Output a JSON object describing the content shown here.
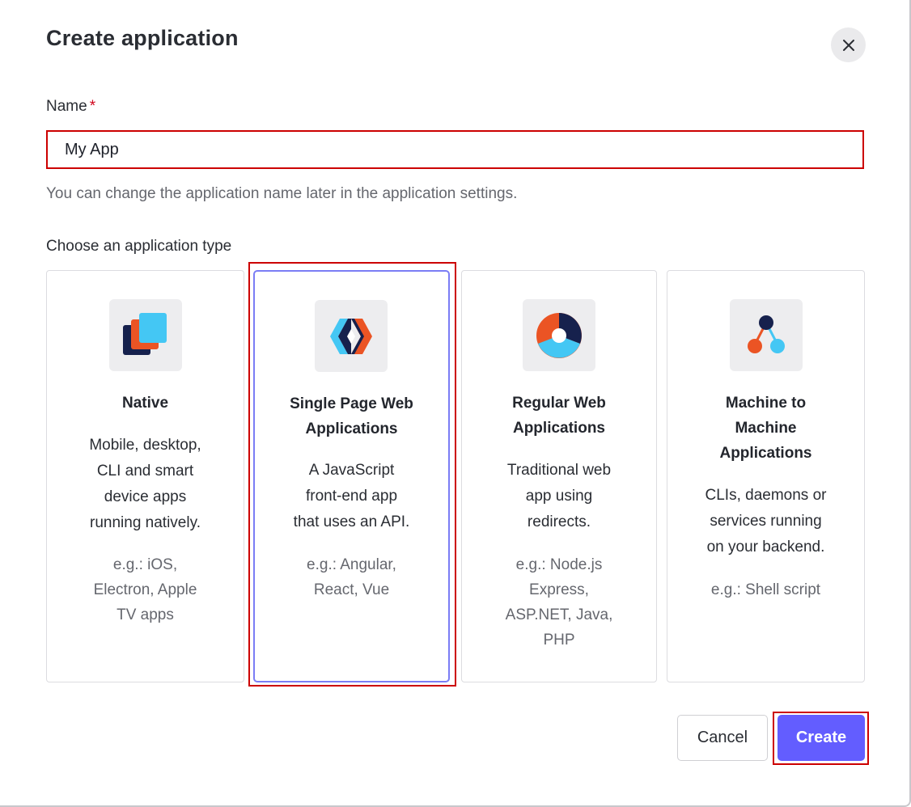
{
  "dialog": {
    "title": "Create application",
    "close_icon": "close-icon"
  },
  "name_field": {
    "label": "Name",
    "required_marker": "*",
    "value": "My App",
    "helper": "You can change the application name later in the application settings."
  },
  "app_type": {
    "label": "Choose an application type",
    "selected": "Single Page Web Applications",
    "cards": [
      {
        "icon": "native-stacked-squares-icon",
        "title_lines": [
          "Native"
        ],
        "desc_lines": [
          "Mobile, desktop,",
          "CLI and smart",
          "device apps",
          "running natively."
        ],
        "example_lines": [
          "e.g.: iOS,",
          "Electron, Apple",
          "TV apps"
        ]
      },
      {
        "icon": "spa-diamond-icon",
        "title_lines": [
          "Single Page Web",
          "Applications"
        ],
        "desc_lines": [
          "A JavaScript",
          "front-end app",
          "that uses an API."
        ],
        "example_lines": [
          "e.g.: Angular,",
          "React, Vue"
        ]
      },
      {
        "icon": "regular-web-ring-icon",
        "title_lines": [
          "Regular Web",
          "Applications"
        ],
        "desc_lines": [
          "Traditional web",
          "app using",
          "redirects."
        ],
        "example_lines": [
          "e.g.: Node.js",
          "Express,",
          "ASP.NET, Java,",
          "PHP"
        ]
      },
      {
        "icon": "m2m-nodes-icon",
        "title_lines": [
          "Machine to",
          "Machine",
          "Applications"
        ],
        "desc_lines": [
          "CLIs, daemons or",
          "services running",
          "on your backend."
        ],
        "example_lines": [
          "e.g.: Shell script"
        ]
      }
    ]
  },
  "footer": {
    "cancel_label": "Cancel",
    "create_label": "Create"
  },
  "colors": {
    "primary": "#635dff",
    "selected_border": "#7b7df5",
    "highlight_annotation": "#cc0000",
    "brand_orange": "#eb5424",
    "brand_navy": "#16214d",
    "brand_cyan": "#44c7f4"
  }
}
